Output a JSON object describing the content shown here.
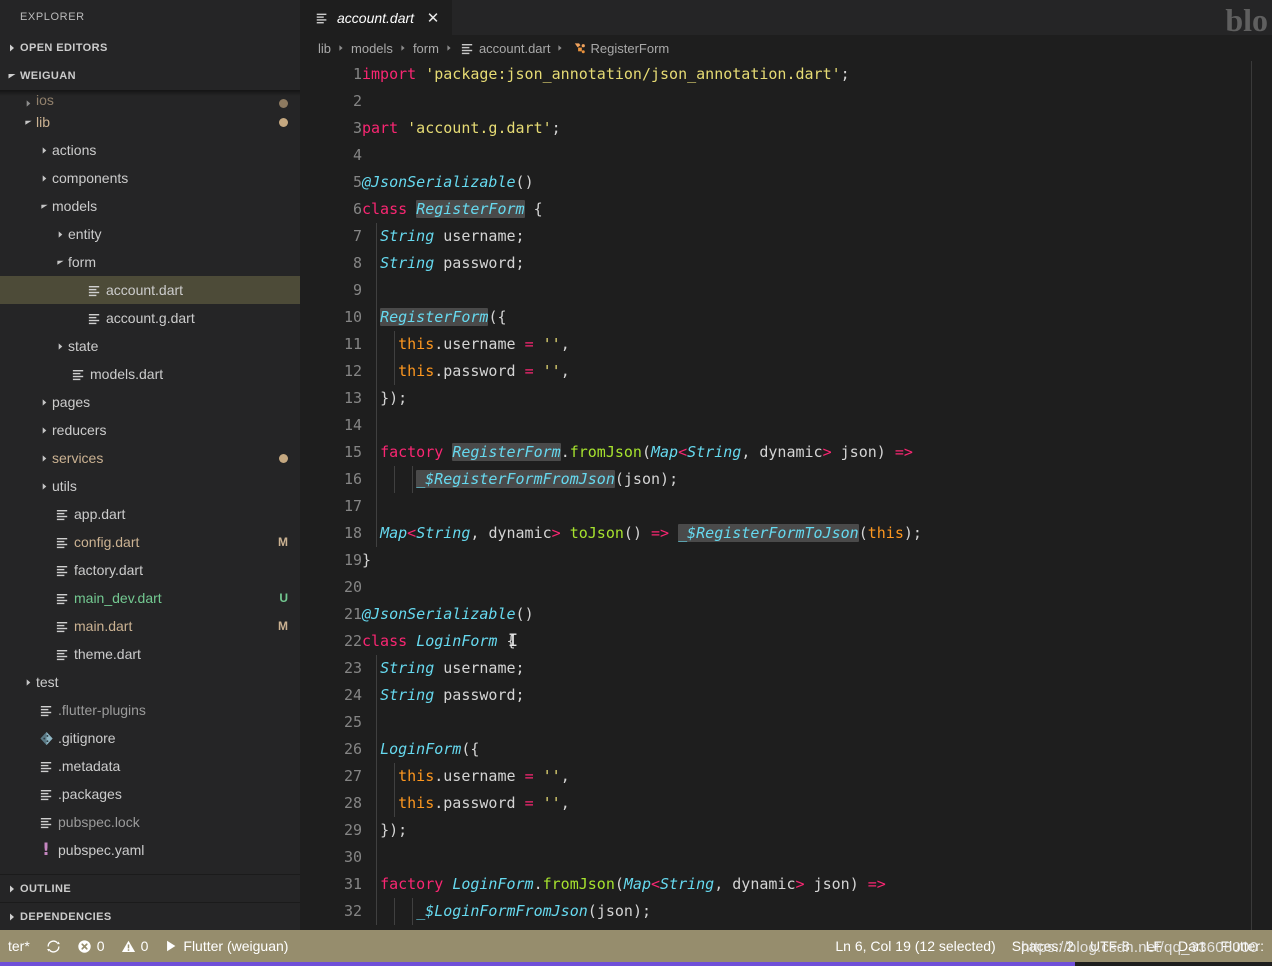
{
  "window": {
    "watermark_top_right": "blo",
    "watermark_bottom": "https://blog.csdn.net/qq_33608000"
  },
  "sidebar": {
    "title": "EXPLORER",
    "sections": [
      {
        "label": "OPEN EDITORS",
        "expanded": false
      },
      {
        "label": "WEIGUAN",
        "expanded": true
      }
    ],
    "bottom_sections": [
      {
        "label": "OUTLINE",
        "expanded": false
      },
      {
        "label": "DEPENDENCIES",
        "expanded": false
      }
    ],
    "tree": [
      {
        "label": "ios",
        "indent": 1,
        "kind": "folder",
        "expanded": false,
        "selected": false,
        "color": "orange",
        "dot": true,
        "badge": "",
        "clipped": true
      },
      {
        "label": "lib",
        "indent": 1,
        "kind": "folder",
        "expanded": true,
        "selected": false,
        "color": "orange",
        "dot": true,
        "badge": ""
      },
      {
        "label": "actions",
        "indent": 2,
        "kind": "folder",
        "expanded": false,
        "selected": false,
        "color": "gray",
        "dot": false,
        "badge": ""
      },
      {
        "label": "components",
        "indent": 2,
        "kind": "folder",
        "expanded": false,
        "selected": false,
        "color": "gray",
        "dot": false,
        "badge": ""
      },
      {
        "label": "models",
        "indent": 2,
        "kind": "folder",
        "expanded": true,
        "selected": false,
        "color": "gray",
        "dot": false,
        "badge": ""
      },
      {
        "label": "entity",
        "indent": 3,
        "kind": "folder",
        "expanded": false,
        "selected": false,
        "color": "gray",
        "dot": false,
        "badge": ""
      },
      {
        "label": "form",
        "indent": 3,
        "kind": "folder",
        "expanded": true,
        "selected": false,
        "color": "gray",
        "dot": false,
        "badge": ""
      },
      {
        "label": "account.dart",
        "indent": 4,
        "kind": "file",
        "expanded": false,
        "selected": true,
        "color": "gray",
        "dot": false,
        "badge": ""
      },
      {
        "label": "account.g.dart",
        "indent": 4,
        "kind": "file",
        "expanded": false,
        "selected": false,
        "color": "gray",
        "dot": false,
        "badge": ""
      },
      {
        "label": "state",
        "indent": 3,
        "kind": "folder",
        "expanded": false,
        "selected": false,
        "color": "gray",
        "dot": false,
        "badge": ""
      },
      {
        "label": "models.dart",
        "indent": 3,
        "kind": "file",
        "expanded": false,
        "selected": false,
        "color": "gray",
        "dot": false,
        "badge": ""
      },
      {
        "label": "pages",
        "indent": 2,
        "kind": "folder",
        "expanded": false,
        "selected": false,
        "color": "gray",
        "dot": false,
        "badge": ""
      },
      {
        "label": "reducers",
        "indent": 2,
        "kind": "folder",
        "expanded": false,
        "selected": false,
        "color": "gray",
        "dot": false,
        "badge": ""
      },
      {
        "label": "services",
        "indent": 2,
        "kind": "folder",
        "expanded": false,
        "selected": false,
        "color": "orange",
        "dot": true,
        "badge": ""
      },
      {
        "label": "utils",
        "indent": 2,
        "kind": "folder",
        "expanded": false,
        "selected": false,
        "color": "gray",
        "dot": false,
        "badge": ""
      },
      {
        "label": "app.dart",
        "indent": 2,
        "kind": "file",
        "expanded": false,
        "selected": false,
        "color": "gray",
        "dot": false,
        "badge": ""
      },
      {
        "label": "config.dart",
        "indent": 2,
        "kind": "file",
        "expanded": false,
        "selected": false,
        "color": "orange",
        "dot": false,
        "badge": "M"
      },
      {
        "label": "factory.dart",
        "indent": 2,
        "kind": "file",
        "expanded": false,
        "selected": false,
        "color": "gray",
        "dot": false,
        "badge": ""
      },
      {
        "label": "main_dev.dart",
        "indent": 2,
        "kind": "file",
        "expanded": false,
        "selected": false,
        "color": "green",
        "dot": false,
        "badge": "U"
      },
      {
        "label": "main.dart",
        "indent": 2,
        "kind": "file",
        "expanded": false,
        "selected": false,
        "color": "orange",
        "dot": false,
        "badge": "M"
      },
      {
        "label": "theme.dart",
        "indent": 2,
        "kind": "file",
        "expanded": false,
        "selected": false,
        "color": "gray",
        "dot": false,
        "badge": ""
      },
      {
        "label": "test",
        "indent": 1,
        "kind": "folder",
        "expanded": false,
        "selected": false,
        "color": "gray",
        "dot": false,
        "badge": ""
      },
      {
        "label": ".flutter-plugins",
        "indent": 1,
        "kind": "file",
        "expanded": false,
        "selected": false,
        "color": "dim",
        "dot": false,
        "badge": ""
      },
      {
        "label": ".gitignore",
        "indent": 1,
        "kind": "git",
        "expanded": false,
        "selected": false,
        "color": "gray",
        "dot": false,
        "badge": ""
      },
      {
        "label": ".metadata",
        "indent": 1,
        "kind": "file",
        "expanded": false,
        "selected": false,
        "color": "gray",
        "dot": false,
        "badge": ""
      },
      {
        "label": ".packages",
        "indent": 1,
        "kind": "file",
        "expanded": false,
        "selected": false,
        "color": "gray",
        "dot": false,
        "badge": ""
      },
      {
        "label": "pubspec.lock",
        "indent": 1,
        "kind": "file",
        "expanded": false,
        "selected": false,
        "color": "dim",
        "dot": false,
        "badge": ""
      },
      {
        "label": "pubspec.yaml",
        "indent": 1,
        "kind": "yaml",
        "expanded": false,
        "selected": false,
        "color": "gray",
        "dot": false,
        "badge": ""
      }
    ]
  },
  "editor": {
    "tab": {
      "label": "account.dart",
      "icon": "dart-file-icon",
      "dirty": false,
      "close_glyph": "✕"
    },
    "breadcrumbs": [
      {
        "label": "lib",
        "icon": ""
      },
      {
        "label": "models",
        "icon": ""
      },
      {
        "label": "form",
        "icon": ""
      },
      {
        "label": "account.dart",
        "icon": "dart-file-icon"
      },
      {
        "label": "RegisterForm",
        "icon": "class-symbol-icon"
      }
    ],
    "first_line": 1,
    "last_line": 32,
    "highlight_word": "RegisterForm",
    "caret": {
      "line": 6,
      "col": 19
    },
    "lines": [
      {
        "n": 1,
        "text": "import 'package:json_annotation/json_annotation.dart';"
      },
      {
        "n": 2,
        "text": ""
      },
      {
        "n": 3,
        "text": "part 'account.g.dart';"
      },
      {
        "n": 4,
        "text": ""
      },
      {
        "n": 5,
        "text": "@JsonSerializable()"
      },
      {
        "n": 6,
        "text": "class RegisterForm {"
      },
      {
        "n": 7,
        "text": "  String username;"
      },
      {
        "n": 8,
        "text": "  String password;"
      },
      {
        "n": 9,
        "text": ""
      },
      {
        "n": 10,
        "text": "  RegisterForm({"
      },
      {
        "n": 11,
        "text": "    this.username = '',"
      },
      {
        "n": 12,
        "text": "    this.password = '',"
      },
      {
        "n": 13,
        "text": "  });"
      },
      {
        "n": 14,
        "text": ""
      },
      {
        "n": 15,
        "text": "  factory RegisterForm.fromJson(Map<String, dynamic> json) =>"
      },
      {
        "n": 16,
        "text": "      _$RegisterFormFromJson(json);"
      },
      {
        "n": 17,
        "text": ""
      },
      {
        "n": 18,
        "text": "  Map<String, dynamic> toJson() => _$RegisterFormToJson(this);"
      },
      {
        "n": 19,
        "text": "}"
      },
      {
        "n": 20,
        "text": ""
      },
      {
        "n": 21,
        "text": "@JsonSerializable()"
      },
      {
        "n": 22,
        "text": "class LoginForm {"
      },
      {
        "n": 23,
        "text": "  String username;"
      },
      {
        "n": 24,
        "text": "  String password;"
      },
      {
        "n": 25,
        "text": ""
      },
      {
        "n": 26,
        "text": "  LoginForm({"
      },
      {
        "n": 27,
        "text": "    this.username = '',"
      },
      {
        "n": 28,
        "text": "    this.password = '',"
      },
      {
        "n": 29,
        "text": "  });"
      },
      {
        "n": 30,
        "text": ""
      },
      {
        "n": 31,
        "text": "  factory LoginForm.fromJson(Map<String, dynamic> json) =>"
      },
      {
        "n": 32,
        "text": "      _$LoginFormFromJson(json);"
      }
    ]
  },
  "statusbar": {
    "left": [
      {
        "name": "branch",
        "text": "ter*",
        "icon": ""
      },
      {
        "name": "sync",
        "text": "",
        "icon": "sync-icon"
      },
      {
        "name": "errors",
        "text": "0",
        "icon": "error-icon"
      },
      {
        "name": "warnings",
        "text": "0",
        "icon": "warning-icon"
      },
      {
        "name": "run-target",
        "text": "Flutter (weiguan)",
        "icon": "play-icon"
      }
    ],
    "right": [
      {
        "name": "cursor-position",
        "text": "Ln 6, Col 19 (12 selected)"
      },
      {
        "name": "indentation",
        "text": "Spaces: 2"
      },
      {
        "name": "encoding",
        "text": "UTF-8"
      },
      {
        "name": "eol",
        "text": "LF"
      },
      {
        "name": "language-mode",
        "text": "Dart"
      },
      {
        "name": "flutter-device",
        "text": "Flutter:"
      }
    ],
    "colors": {
      "background": "#968d6d",
      "foreground": "#ffffff",
      "progress": "#6f4fd8"
    }
  }
}
